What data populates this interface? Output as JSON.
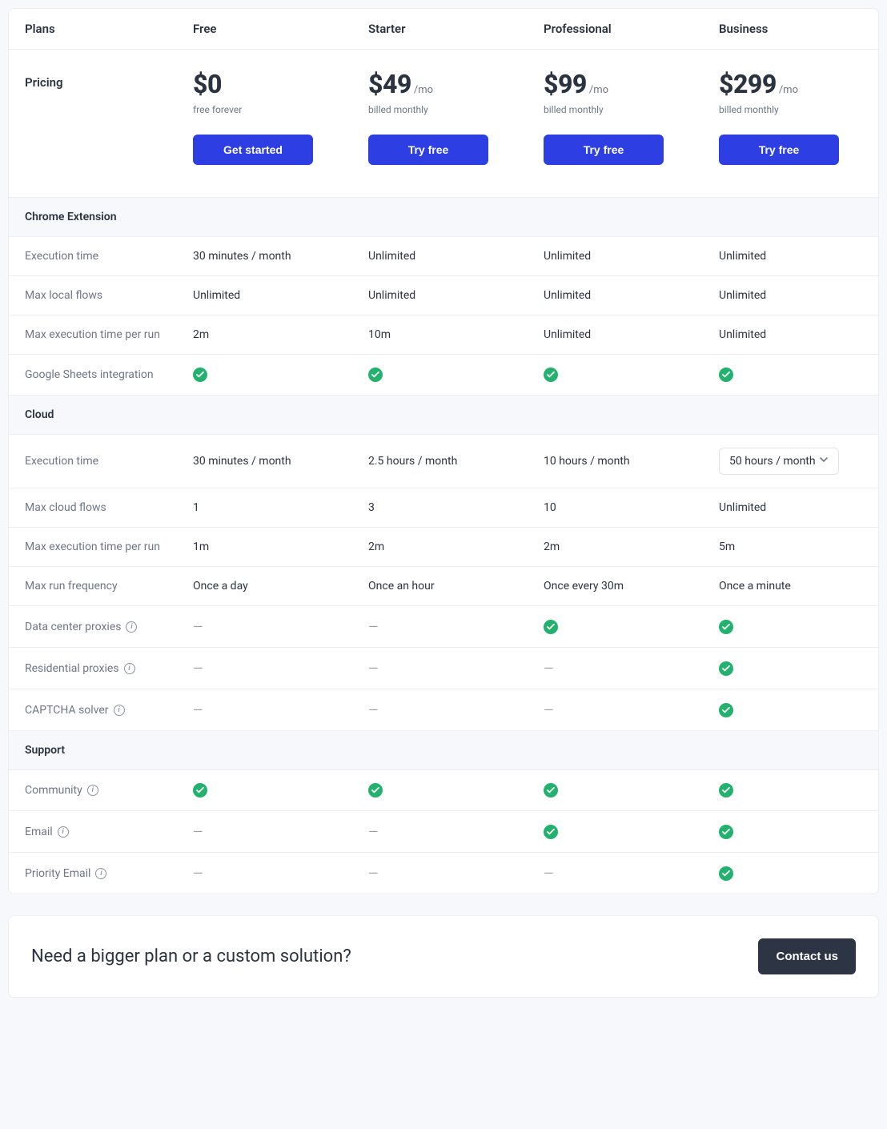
{
  "header": {
    "plansLabel": "Plans",
    "cols": [
      "Free",
      "Starter",
      "Professional",
      "Business"
    ]
  },
  "pricing": {
    "label": "Pricing",
    "plans": [
      {
        "price": "$0",
        "per": "",
        "sub": "free forever",
        "cta": "Get started"
      },
      {
        "price": "$49",
        "per": "/mo",
        "sub": "billed monthly",
        "cta": "Try free"
      },
      {
        "price": "$99",
        "per": "/mo",
        "sub": "billed monthly",
        "cta": "Try free"
      },
      {
        "price": "$299",
        "per": "/mo",
        "sub": "billed monthly",
        "cta": "Try free"
      }
    ]
  },
  "sections": [
    {
      "title": "Chrome Extension",
      "rows": [
        {
          "label": "Execution time",
          "info": false,
          "vals": [
            "30 minutes / month",
            "Unlimited",
            "Unlimited",
            "Unlimited"
          ]
        },
        {
          "label": "Max local flows",
          "info": false,
          "vals": [
            "Unlimited",
            "Unlimited",
            "Unlimited",
            "Unlimited"
          ]
        },
        {
          "label": "Max execution time per run",
          "info": false,
          "vals": [
            "2m",
            "10m",
            "Unlimited",
            "Unlimited"
          ]
        },
        {
          "label": "Google Sheets integration",
          "info": false,
          "vals": [
            "check",
            "check",
            "check",
            "check"
          ]
        }
      ]
    },
    {
      "title": "Cloud",
      "rows": [
        {
          "label": "Execution time",
          "info": false,
          "vals": [
            "30 minutes / month",
            "2.5 hours / month",
            "10 hours / month",
            {
              "dropdown": "50 hours / month"
            }
          ]
        },
        {
          "label": "Max cloud flows",
          "info": false,
          "vals": [
            "1",
            "3",
            "10",
            "Unlimited"
          ]
        },
        {
          "label": "Max execution time per run",
          "info": false,
          "vals": [
            "1m",
            "2m",
            "2m",
            "5m"
          ]
        },
        {
          "label": "Max run frequency",
          "info": false,
          "vals": [
            "Once a day",
            "Once an hour",
            "Once every 30m",
            "Once a minute"
          ]
        },
        {
          "label": "Data center proxies",
          "info": true,
          "vals": [
            "dash",
            "dash",
            "check",
            "check"
          ]
        },
        {
          "label": "Residential proxies",
          "info": true,
          "vals": [
            "dash",
            "dash",
            "dash",
            "check"
          ]
        },
        {
          "label": "CAPTCHA solver",
          "info": true,
          "vals": [
            "dash",
            "dash",
            "dash",
            "check"
          ]
        }
      ]
    },
    {
      "title": "Support",
      "rows": [
        {
          "label": "Community",
          "info": true,
          "vals": [
            "check",
            "check",
            "check",
            "check"
          ]
        },
        {
          "label": "Email",
          "info": true,
          "vals": [
            "dash",
            "dash",
            "check",
            "check"
          ]
        },
        {
          "label": "Priority Email",
          "info": true,
          "vals": [
            "dash",
            "dash",
            "dash",
            "check"
          ]
        }
      ]
    }
  ],
  "footer": {
    "question": "Need a bigger plan or a custom solution?",
    "cta": "Contact us"
  }
}
